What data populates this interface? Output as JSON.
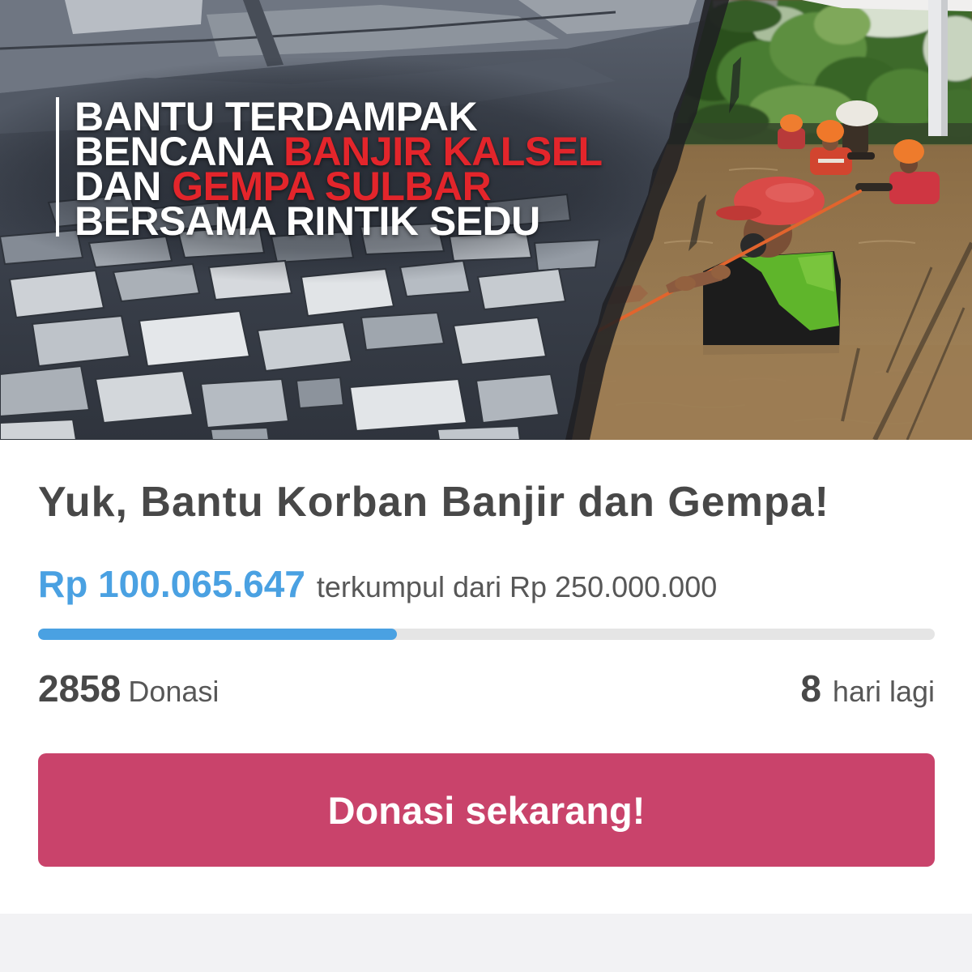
{
  "banner": {
    "headline": {
      "line1": "BANTU TERDAMPAK",
      "line2_prefix": "BENCANA",
      "line2_highlight": "BANJIR KALSEL",
      "line3_prefix": "DAN",
      "line3_highlight": "GEMPA SULBAR",
      "line4": "BERSAMA RINTIK SEDU"
    }
  },
  "campaign": {
    "title": "Yuk, Bantu Korban Banjir dan Gempa!",
    "amount_collected": "Rp 100.065.647",
    "collected_label": "terkumpul dari",
    "target_amount": "Rp 250.000.000",
    "progress_fraction": 0.4003,
    "donation_count": "2858",
    "donation_label": "Donasi",
    "days_left": "8",
    "days_left_label": "hari lagi"
  },
  "cta": {
    "label": "Donasi sekarang!"
  },
  "theme": {
    "text_dark": "#484848",
    "text_muted": "#575757",
    "accent_blue": "#4aa1e2",
    "progress_track": "#e5e5e5",
    "cta_background": "#c9436b",
    "cta_text": "#ffffff",
    "footer_background": "#f2f2f4",
    "headline_text": "#ffffff",
    "headline_highlight": "#e3252b"
  }
}
